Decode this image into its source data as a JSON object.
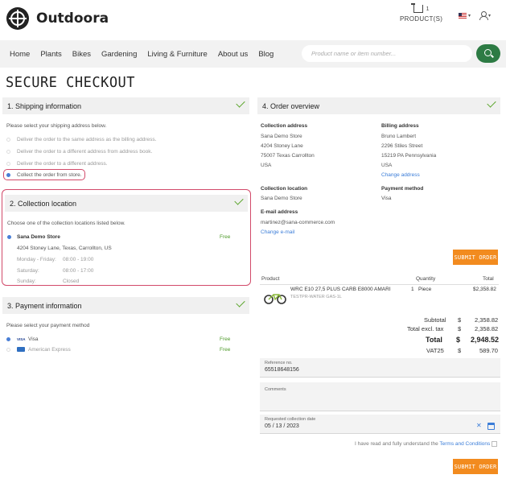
{
  "brand": {
    "name": "Outdoora"
  },
  "cart": {
    "count": "1",
    "label": "PRODUCT(S)"
  },
  "nav": {
    "items": [
      "Home",
      "Plants",
      "Bikes",
      "Gardening",
      "Living & Furniture",
      "About us",
      "Blog"
    ],
    "search_placeholder": "Product name or item number..."
  },
  "page_title": "SECURE CHECKOUT",
  "shipping": {
    "title": "1.  Shipping information",
    "prompt": "Please select your shipping address below.",
    "options": [
      "Deliver the order to the same address as the billing address.",
      "Deliver the order to a different address from address book.",
      "Deliver the order to a different address.",
      "Collect the order from store."
    ],
    "selected_index": 3
  },
  "collection": {
    "title": "2.  Collection location",
    "prompt": "Choose one of the collection locations listed below.",
    "store_name": "Sana Demo Store",
    "store_fee": "Free",
    "store_address": "4204 Stoney Lane, Texas, Carrollton, US",
    "hours": [
      {
        "day": "Monday - Friday:",
        "time": "08:00 - 19:00"
      },
      {
        "day": "Saturday:",
        "time": "08:00 - 17:00"
      },
      {
        "day": "Sunday:",
        "time": "Closed"
      }
    ]
  },
  "payment": {
    "title": "3.  Payment information",
    "prompt": "Please select your payment method",
    "methods": [
      {
        "logo": "VISA",
        "name": "Visa",
        "fee": "Free",
        "selected": true
      },
      {
        "logo": "",
        "name": "American Express",
        "fee": "Free",
        "selected": false
      }
    ]
  },
  "overview": {
    "title": "4.  Order overview",
    "collection_address_label": "Collection address",
    "collection_address": [
      "Sana Demo Store",
      "4204 Stoney Lane",
      "75007 Texas Carrollton",
      "USA"
    ],
    "billing_address_label": "Billing address",
    "billing_address": [
      "Bruno Lambert",
      "2296 Stiles Street",
      "15219 PA Pennsylvania",
      "USA"
    ],
    "change_address": "Change address",
    "collection_location_label": "Collection location",
    "collection_location": "Sana Demo Store",
    "payment_method_label": "Payment method",
    "payment_method": "Visa",
    "email_label": "E-mail address",
    "email": "martinez@sana-commerce.com",
    "change_email": "Change e-mail",
    "submit_label": "SUBMIT ORDER"
  },
  "order_table": {
    "headers": {
      "product": "Product",
      "quantity": "Quantity",
      "total": "Total"
    },
    "rows": [
      {
        "name": "WRC E10 27,5 PLUS CARB E8000 AMARI",
        "sku": "TESTPR-WATER GAS-1L",
        "qty": "1",
        "unit": "Piece",
        "total": "$2,358.82"
      }
    ]
  },
  "totals": {
    "subtotal_label": "Subtotal",
    "subtotal_cur": "$",
    "subtotal": "2,358.82",
    "excl_label": "Total excl. tax",
    "excl_cur": "$",
    "excl": "2,358.82",
    "total_label": "Total",
    "total_cur": "$",
    "total": "2,948.52",
    "vat_label": "VAT25",
    "vat_cur": "$",
    "vat": "589.70"
  },
  "reference": {
    "label": "Reference no.",
    "value": "65518648156"
  },
  "comments": {
    "label": "Comments"
  },
  "collection_date": {
    "label": "Requested collection date",
    "value": "05 / 13 / 2023"
  },
  "terms": {
    "prefix": "I have read and fully understand the ",
    "link": "Terms and Conditions"
  },
  "colors": {
    "accent_orange": "#f28b1f",
    "brand_green": "#2d7b44",
    "check_green": "#5aa52a",
    "highlight": "#d24a6a",
    "link_blue": "#3b7dd8"
  }
}
